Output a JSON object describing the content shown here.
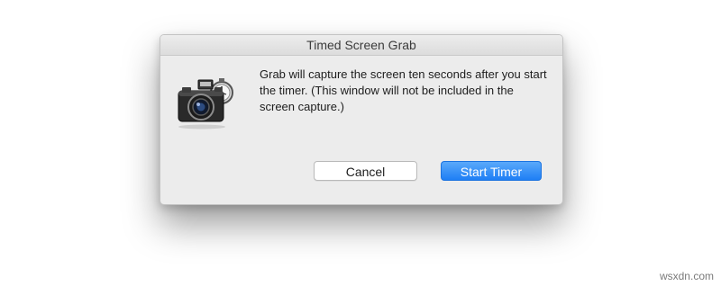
{
  "dialog": {
    "title": "Timed Screen Grab",
    "message": "Grab will capture the screen ten seconds after you start the timer.  (This window will not be included in the screen capture.)",
    "icon": "camera-timer-icon",
    "buttons": {
      "cancel_label": "Cancel",
      "start_label": "Start Timer"
    }
  },
  "watermark": "wsxdn.com",
  "colors": {
    "dialog_background": "#ececec",
    "accent": "#1e7ff5"
  }
}
